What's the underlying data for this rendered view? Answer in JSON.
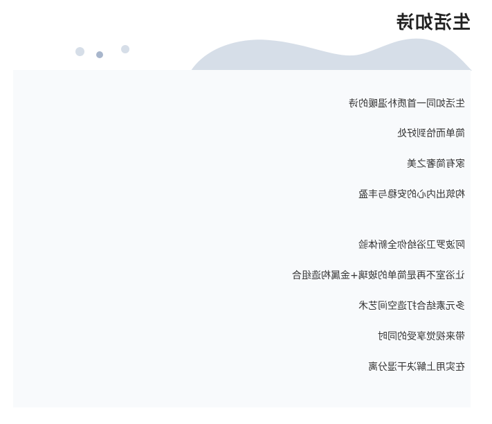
{
  "title": "生活如诗",
  "colors": {
    "wave": "#d6dee8",
    "card_bg": "#f8fafc",
    "dot_light": "#d6dee8",
    "dot_dark": "#a8b6cc"
  },
  "paragraphs": [
    {
      "lines": [
        "生活如同一首质朴温暖的诗",
        "简单而恰到好处",
        "家有简奢之美",
        "构筑出内心的安稳与丰盈"
      ]
    },
    {
      "lines": [
        "阿波罗卫浴给你全新体验",
        "让浴室不再是简单的玻璃+金属构造组合",
        "多元素结合打造空间艺术",
        "带来视觉享受的同时",
        "在实用上解决干湿分离"
      ]
    }
  ]
}
